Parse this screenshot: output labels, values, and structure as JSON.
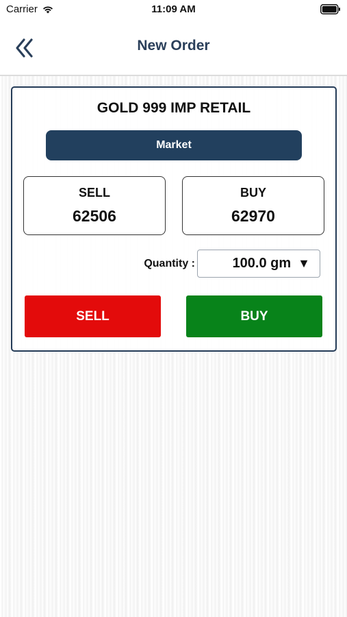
{
  "status_bar": {
    "carrier": "Carrier",
    "time": "11:09 AM",
    "wifi_icon": "wifi-icon",
    "battery_icon": "battery-icon"
  },
  "nav": {
    "title": "New Order",
    "back_icon": "double-chevron-left-icon",
    "title_color": "#2a3f5a"
  },
  "order": {
    "product": "GOLD 999 IMP RETAIL",
    "order_type": "Market",
    "sell_label": "SELL",
    "sell_price": "62506",
    "buy_label": "BUY",
    "buy_price": "62970",
    "quantity_label": "Quantity :",
    "quantity_value": "100.0 gm",
    "quantity_caret": "▼",
    "sell_button_label": "SELL",
    "buy_button_label": "BUY"
  },
  "colors": {
    "brand_navy": "#22405e",
    "sell_red": "#e30b0b",
    "buy_green": "#08831a"
  }
}
